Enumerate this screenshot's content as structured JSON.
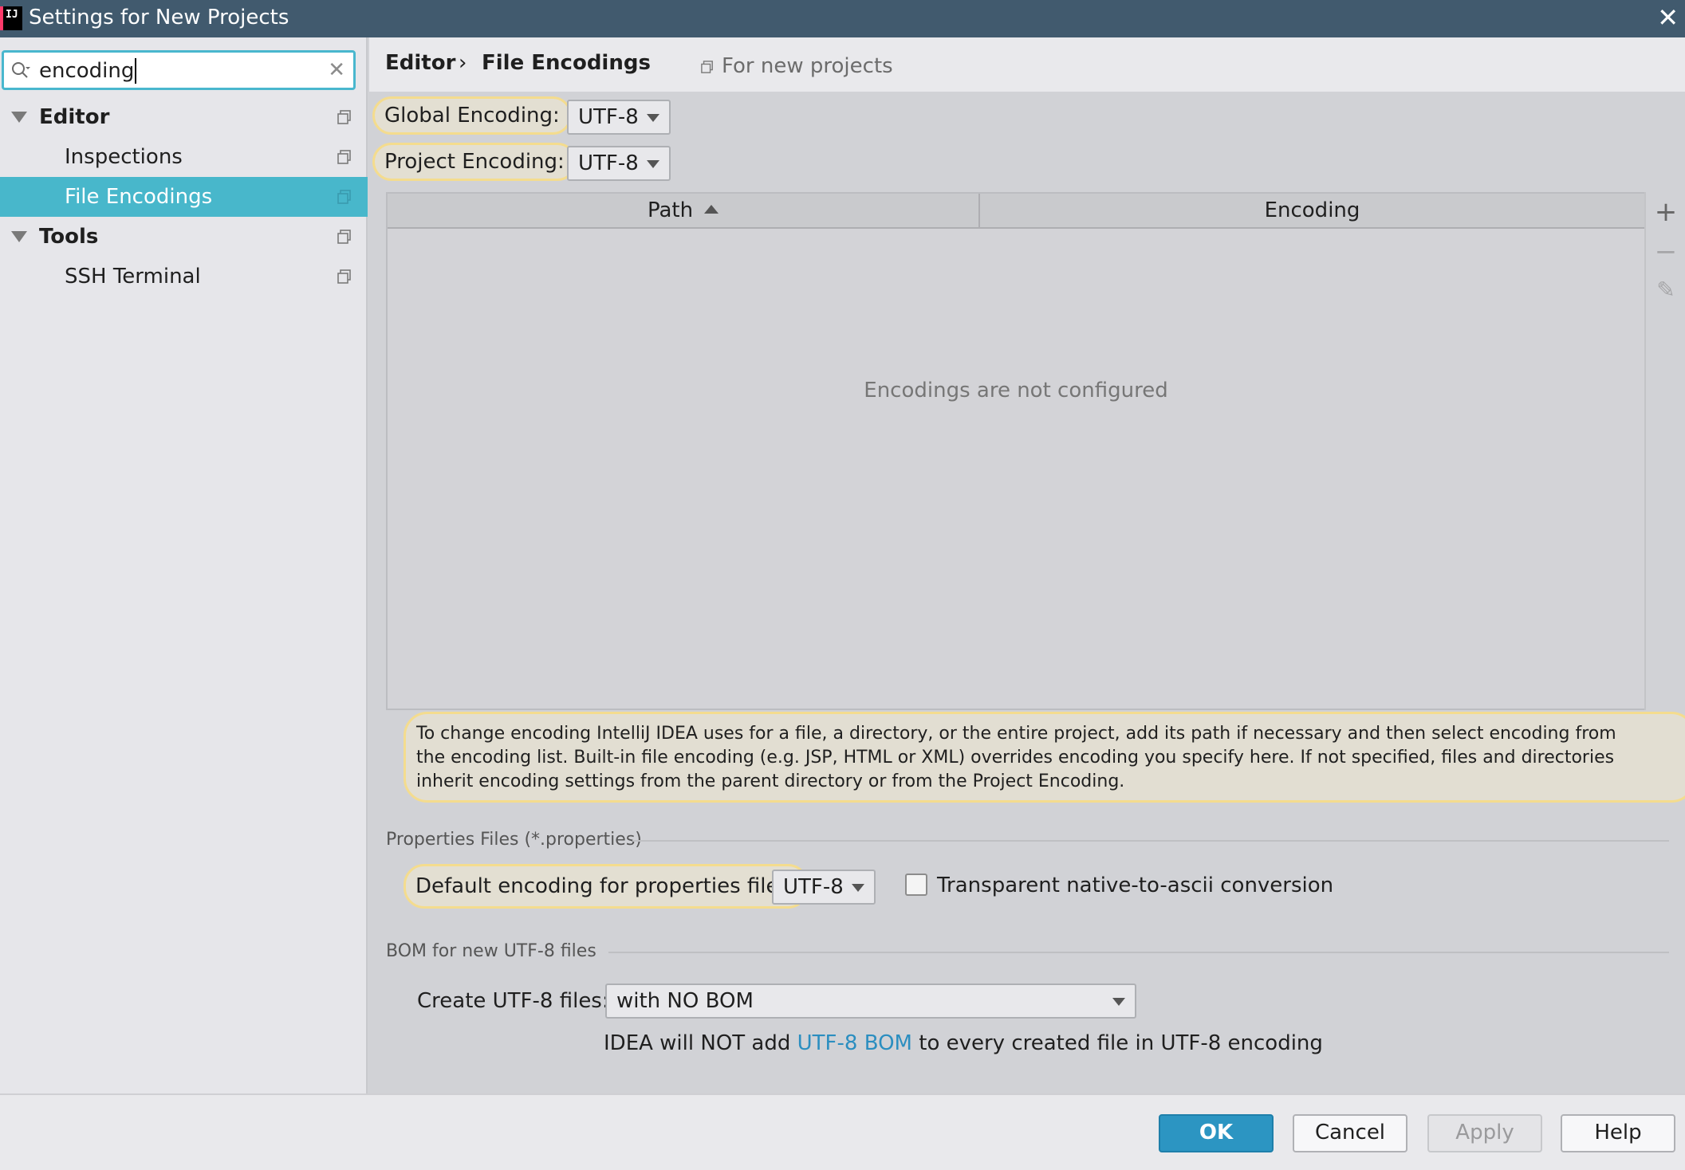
{
  "window": {
    "title": "Settings for New Projects",
    "app_icon": "IJ"
  },
  "sidebar": {
    "search": {
      "value": "encoding"
    },
    "items": [
      {
        "label": "Editor",
        "bold": true,
        "expanded": true
      },
      {
        "label": "Inspections"
      },
      {
        "label": "File Encodings",
        "selected": true
      },
      {
        "label": "Tools",
        "bold": true,
        "expanded": true
      },
      {
        "label": "SSH Terminal"
      }
    ]
  },
  "header": {
    "breadcrumb": [
      "Editor",
      "File Encodings"
    ],
    "separator": "›",
    "scope": "For new projects"
  },
  "encodings": {
    "global_label": "Global Encoding:",
    "global_value": "UTF-8",
    "project_label": "Project Encoding:",
    "project_value": "UTF-8"
  },
  "table": {
    "columns": [
      "Path",
      "Encoding"
    ],
    "empty_text": "Encodings are not configured",
    "tools": [
      "+",
      "−",
      "✎"
    ]
  },
  "help_text": "To change encoding IntelliJ IDEA uses for a file, a directory, or the entire project, add its path if necessary and then select encoding from the encoding list. Built-in file encoding (e.g. JSP, HTML or XML) overrides encoding you specify here. If not specified, files and directories inherit encoding settings from the parent directory or from the Project Encoding.",
  "properties": {
    "section_title": "Properties Files (*.properties)",
    "default_label": "Default encoding for properties files:",
    "default_value": "UTF-8",
    "transparent_label": "Transparent native-to-ascii conversion",
    "transparent_checked": false
  },
  "bom": {
    "section_title": "BOM for new UTF-8 files",
    "create_label": "Create UTF-8 files:",
    "create_value": "with NO BOM",
    "note_prefix": "IDEA will NOT add ",
    "note_link": "UTF-8 BOM",
    "note_suffix": " to every created file in UTF-8 encoding"
  },
  "buttons": {
    "ok": "OK",
    "cancel": "Cancel",
    "apply": "Apply",
    "help": "Help"
  },
  "colors": {
    "titlebar": "#415a6e",
    "selection": "#48b7cb",
    "highlight": "#f4dc8e",
    "primary_button": "#2c95c2",
    "link": "#2b8ec0"
  }
}
